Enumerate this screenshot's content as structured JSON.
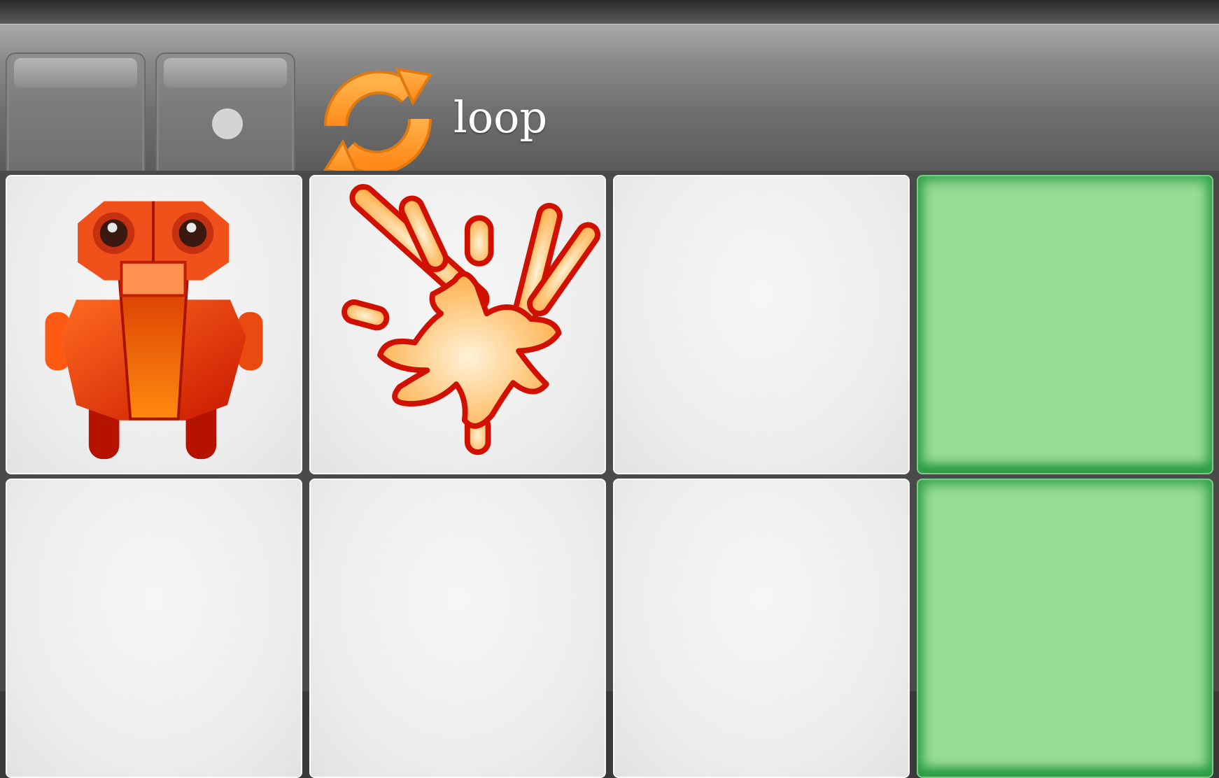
{
  "toolbar": {
    "loop_label": "loop",
    "buttons": [
      {
        "name": "empty-slot-button",
        "icon": "none"
      },
      {
        "name": "dot-button",
        "icon": "dot-icon"
      }
    ],
    "command_icon": "loop-icon"
  },
  "grid": {
    "rows": [
      [
        {
          "content": "robot-icon",
          "goal": false
        },
        {
          "content": "explosion-icon",
          "goal": false
        },
        {
          "content": "empty",
          "goal": false
        },
        {
          "content": "empty",
          "goal": true
        }
      ],
      [
        {
          "content": "empty",
          "goal": false
        },
        {
          "content": "empty",
          "goal": false
        },
        {
          "content": "empty",
          "goal": false
        },
        {
          "content": "empty",
          "goal": true
        }
      ]
    ]
  },
  "colors": {
    "goal_tile": "#98dc98",
    "goal_border": "#2f9f47",
    "robot_primary": "#e8420f",
    "loop_icon": "#ff9a2e"
  }
}
